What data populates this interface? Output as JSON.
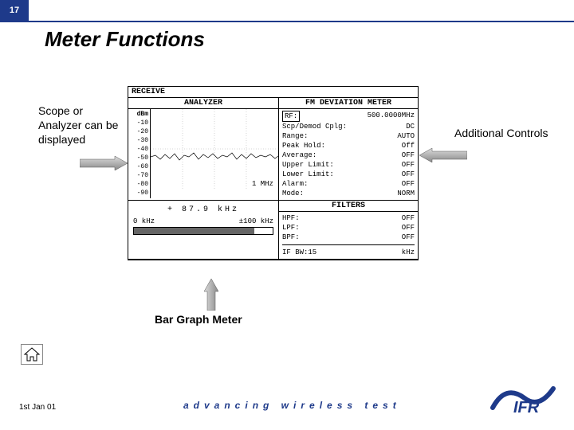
{
  "page_number": "17",
  "title": "Meter Functions",
  "annotations": {
    "left": "Scope or Analyzer can be displayed",
    "right": "Additional Controls",
    "bottom": "Bar Graph Meter"
  },
  "screenshot": {
    "header": "RECEIVE",
    "analyzer": {
      "title": "ANALYZER",
      "y_unit": "dBm",
      "y_ticks": [
        "-10",
        "-20",
        "-30",
        "-40",
        "-50",
        "-60",
        "-70",
        "-80",
        "-90"
      ],
      "x_label": "1 MHz"
    },
    "fm_meter": {
      "title": "FM DEVIATION METER",
      "rf_label": "RF:",
      "rf_value": "500.0000MHz",
      "lines": [
        {
          "k": "Scp/Demod Cplg:",
          "v": "DC"
        },
        {
          "k": "Range:",
          "v": "AUTO"
        },
        {
          "k": "Peak Hold:",
          "v": "Off"
        },
        {
          "k": "Average:",
          "v": "OFF"
        },
        {
          "k": "Upper Limit:",
          "v": "OFF"
        },
        {
          "k": "Lower Limit:",
          "v": "OFF"
        },
        {
          "k": "Alarm:",
          "v": "OFF"
        },
        {
          "k": "Mode:",
          "v": "NORM"
        }
      ]
    },
    "bargraph": {
      "reading": "+ 87.9 kHz",
      "scale_min": "0 kHz",
      "scale_max": "±100 kHz",
      "fill_percent": 87
    },
    "filters": {
      "title": "FILTERS",
      "lines": [
        {
          "k": "HPF:",
          "v": "OFF"
        },
        {
          "k": "LPF:",
          "v": "OFF"
        },
        {
          "k": "BPF:",
          "v": "OFF"
        }
      ],
      "ifbw": {
        "k": "IF BW:15",
        "v": "kHz"
      }
    }
  },
  "footer": {
    "date": "1st Jan 01",
    "tagline": "advancing wireless test"
  }
}
